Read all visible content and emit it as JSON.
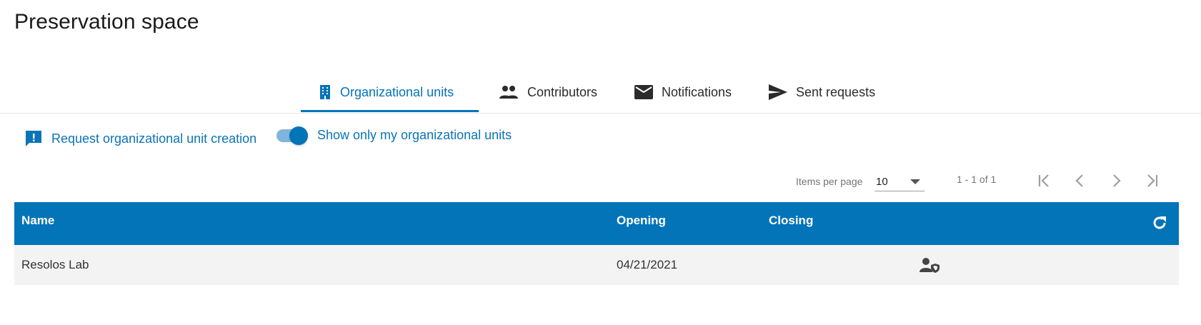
{
  "page": {
    "title": "Preservation space"
  },
  "tabs": [
    {
      "label": "Organizational units",
      "icon": "building-icon",
      "active": true
    },
    {
      "label": "Contributors",
      "icon": "people-icon",
      "active": false
    },
    {
      "label": "Notifications",
      "icon": "mail-icon",
      "active": false
    },
    {
      "label": "Sent requests",
      "icon": "send-icon",
      "active": false
    }
  ],
  "actions": {
    "request_label": "Request organizational unit creation",
    "request_icon": "feedback-icon",
    "toggle_label": "Show only my organizational units",
    "toggle_on": true
  },
  "paginator": {
    "items_per_page_label": "Items per page",
    "items_per_page_value": "10",
    "range_label": "1 - 1 of 1"
  },
  "table": {
    "columns": [
      "Name",
      "Opening",
      "Closing"
    ],
    "rows": [
      {
        "name": "Resolos Lab",
        "opening": "04/21/2021",
        "closing": "",
        "action_icon": "user-shield-icon"
      }
    ]
  },
  "colors": {
    "accent": "#0374b8",
    "row_bg": "#f3f3f3",
    "header_text": "#ffffff"
  }
}
